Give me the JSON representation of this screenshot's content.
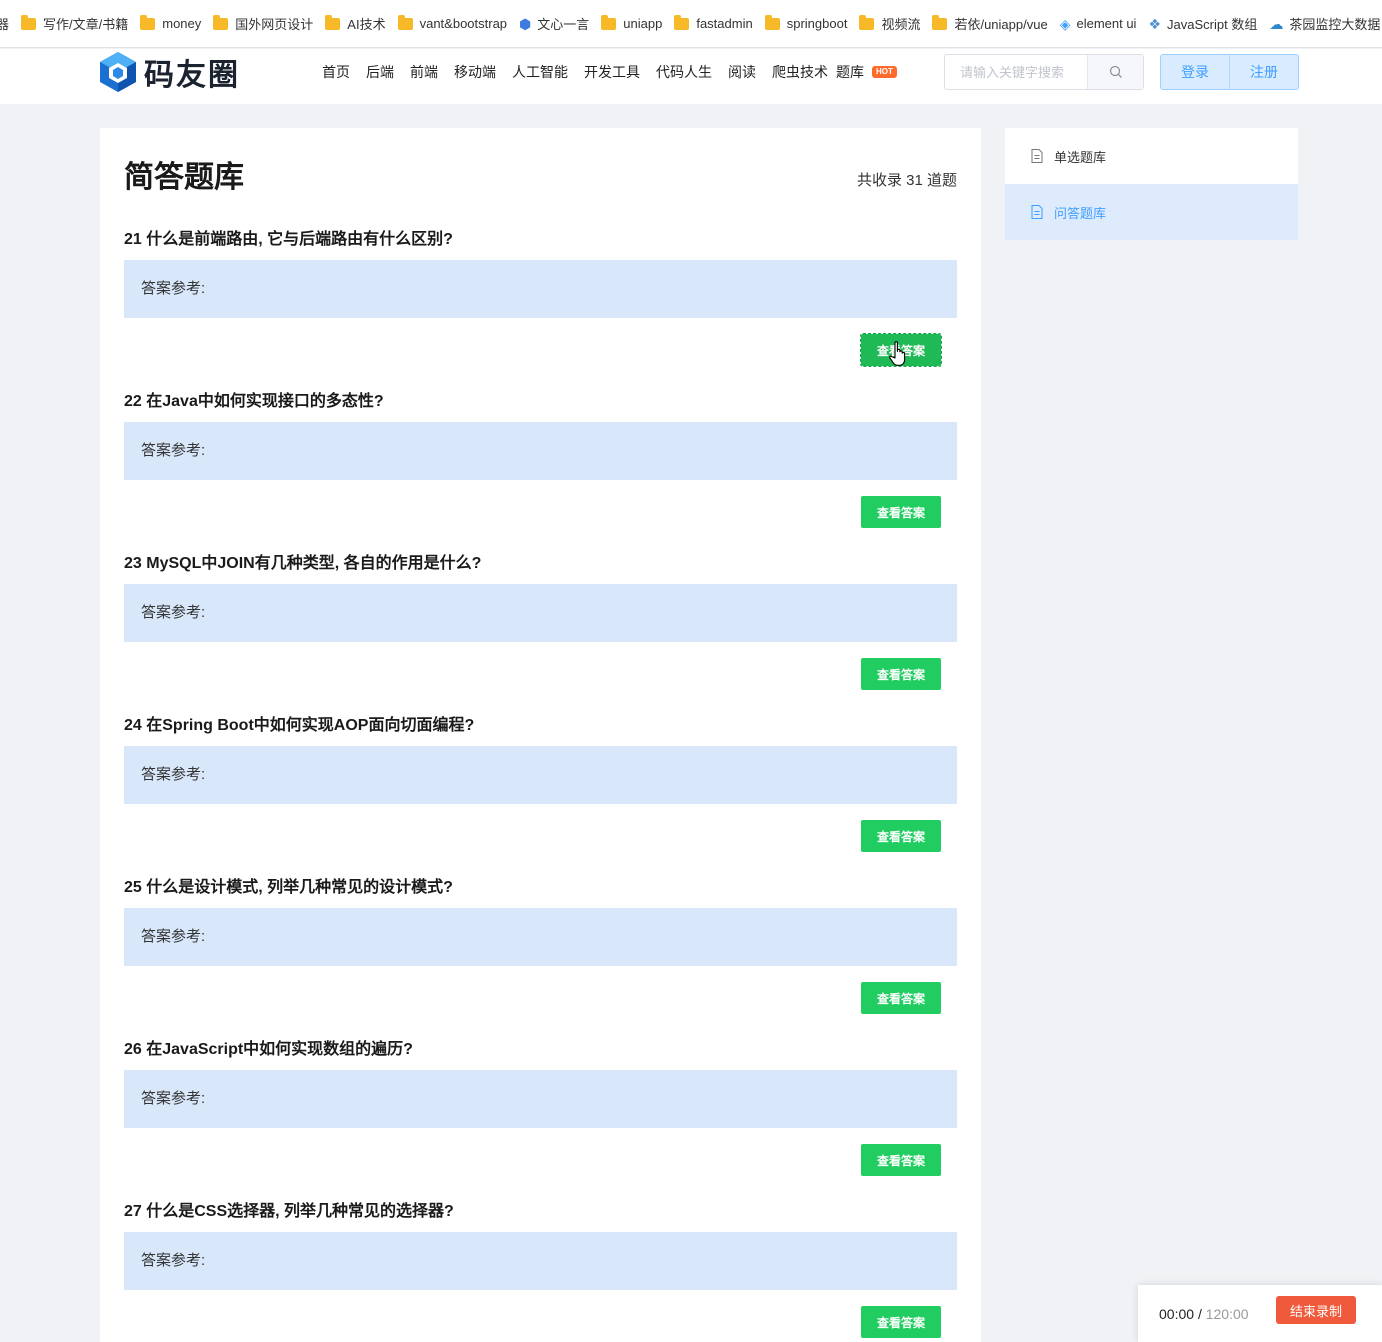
{
  "bookmarks": [
    {
      "label": "器",
      "icon": "cut-off-text"
    },
    {
      "label": "写作/文章/书籍",
      "icon": "folder-icon"
    },
    {
      "label": "money",
      "icon": "folder-icon"
    },
    {
      "label": "国外网页设计",
      "icon": "folder-icon"
    },
    {
      "label": "AI技术",
      "icon": "folder-icon"
    },
    {
      "label": "vant&bootstrap",
      "icon": "folder-icon"
    },
    {
      "label": "文心一言",
      "icon": "cube-icon"
    },
    {
      "label": "uniapp",
      "icon": "folder-icon"
    },
    {
      "label": "fastadmin",
      "icon": "folder-icon"
    },
    {
      "label": "springboot",
      "icon": "folder-icon"
    },
    {
      "label": "视频流",
      "icon": "folder-icon"
    },
    {
      "label": "若依/uniapp/vue",
      "icon": "folder-icon"
    },
    {
      "label": "element ui",
      "icon": "element-icon"
    },
    {
      "label": "JavaScript 数组",
      "icon": "layers-icon"
    },
    {
      "label": "茶园监控大数据",
      "icon": "cloud-icon"
    }
  ],
  "header": {
    "logo_text": "码友圈",
    "nav": [
      "首页",
      "后端",
      "前端",
      "移动端",
      "人工智能",
      "开发工具",
      "代码人生",
      "阅读",
      "爬虫技术"
    ],
    "nav_last": "题库",
    "hot_badge": "HOT",
    "search_placeholder": "请输入关键字搜索",
    "login": "登录",
    "register": "注册"
  },
  "main": {
    "title": "简答题库",
    "total": "共收录 31 道题",
    "answer_label": "答案参考:",
    "view_button": "查看答案",
    "questions": [
      "21 什么是前端路由, 它与后端路由有什么区别?",
      "22 在Java中如何实现接口的多态性?",
      "23 MySQL中JOIN有几种类型, 各自的作用是什么?",
      "24 在Spring Boot中如何实现AOP面向切面编程?",
      "25 什么是设计模式, 列举几种常见的设计模式?",
      "26 在JavaScript中如何实现数组的遍历?",
      "27 什么是CSS选择器, 列举几种常见的选择器?"
    ]
  },
  "sidebar": {
    "items": [
      {
        "label": "单选题库",
        "active": false
      },
      {
        "label": "问答题库",
        "active": true
      }
    ]
  },
  "recorder": {
    "elapsed": "00:00",
    "limit": "120:00",
    "stop": "结束录制"
  },
  "colors": {
    "accent_green": "#21cc60",
    "answer_bg": "#d9e7fb",
    "link_blue": "#409eff",
    "hot_orange": "#ff6b2c",
    "stop_red": "#f05a3c"
  }
}
